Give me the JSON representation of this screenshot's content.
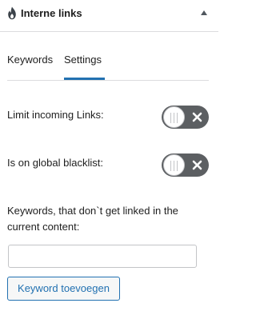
{
  "panel": {
    "title": "Interne links",
    "logo_icon": "flame-drop-icon",
    "collapse_icon": "triangle-up-icon"
  },
  "tabs": [
    {
      "label": "Keywords",
      "active": false
    },
    {
      "label": "Settings",
      "active": true
    }
  ],
  "settings": {
    "limit_incoming": {
      "label": "Limit incoming Links:",
      "enabled": false
    },
    "global_blacklist": {
      "label": "Is on global blacklist:",
      "enabled": false
    }
  },
  "exclude_keywords": {
    "label": "Keywords, that don`t get linked in the current content:",
    "value": "",
    "button_label": "Keyword toevoegen"
  },
  "colors": {
    "accent": "#2271b1",
    "toggle_off": "#5c5f62",
    "border": "#dcdcde"
  }
}
